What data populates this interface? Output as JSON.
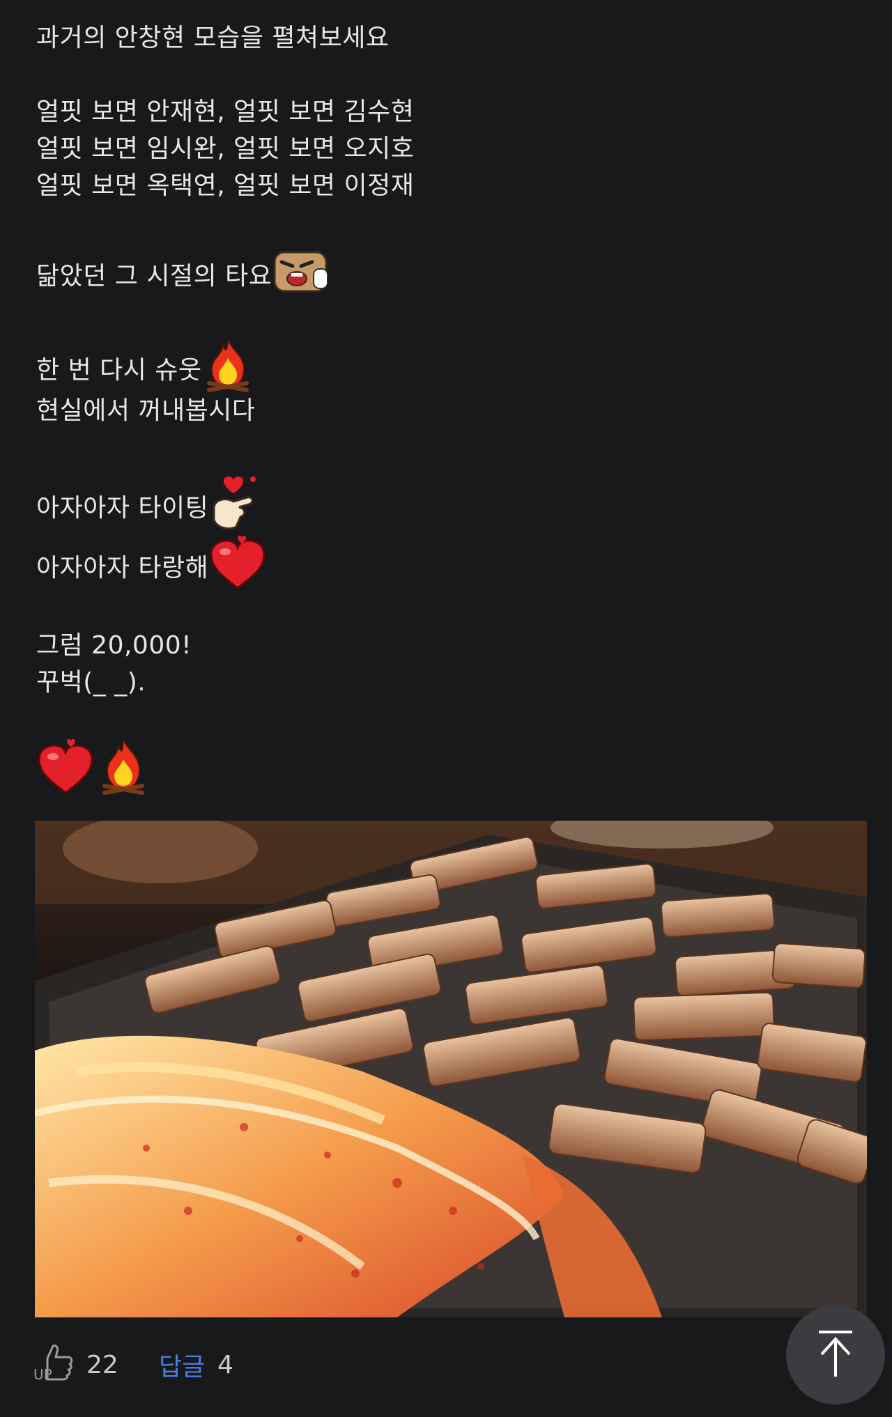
{
  "post": {
    "lines": {
      "l1": "과거의 안창현 모습을 펼쳐보세요",
      "l2": "얼핏 보면 안재현, 얼핏 보면 김수현",
      "l3": "얼핏 보면 임시완, 얼핏 보면 오지호",
      "l4": "얼핏 보면 옥택연, 얼핏 보면 이정재",
      "l5": "닮았던 그 시절의 타요",
      "l6": "한 번 다시 슈웃",
      "l7": "현실에서 꺼내봅시다",
      "l8": "아자아자 타이팅",
      "l9": "아자아자 타랑해",
      "l10": "그럼 20,000!",
      "l11": "꾸벅(_ _)."
    },
    "emojis": {
      "e5": "laughing-face-emoji",
      "e6": "campfire-emoji",
      "e8": "finger-heart-emoji",
      "e9": "red-heart-emoji",
      "end1": "red-heart-emoji",
      "end2": "campfire-emoji"
    },
    "photo": {
      "subject": "grilled pork belly and kimchi on a griddle"
    }
  },
  "footer": {
    "up_label": "UP",
    "up_count": "22",
    "reply_label": "답글",
    "reply_count": "4"
  },
  "colors": {
    "background": "#17191b",
    "text": "#e6e7e8",
    "reply_accent": "#4a7fe0",
    "top_button": "#3a3c3f"
  },
  "icons": {
    "up": "thumbs-up-icon",
    "top": "arrow-up-icon"
  }
}
